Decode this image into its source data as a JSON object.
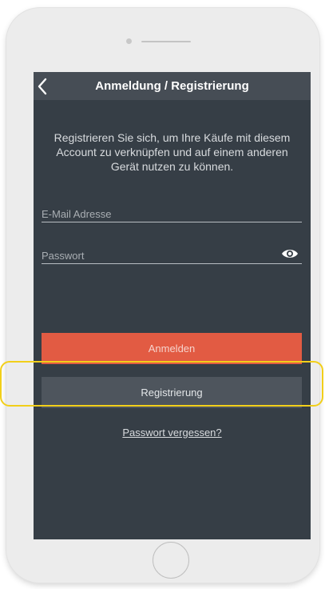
{
  "navbar": {
    "title": "Anmeldung / Registrierung",
    "back_icon": "chevron-left-icon"
  },
  "intro_text": "Registrieren Sie sich, um Ihre Käufe mit diesem Account zu verknüpfen und auf einem anderen Gerät nutzen zu können.",
  "form": {
    "email_placeholder": "E-Mail Adresse",
    "email_value": "",
    "password_placeholder": "Passwort",
    "password_value": "",
    "show_password_icon": "eye-icon"
  },
  "buttons": {
    "login_label": "Anmelden",
    "register_label": "Registrierung"
  },
  "forgot_password_link": "Passwort vergessen?",
  "colors": {
    "screen_background": "#363e46",
    "navbar_background": "#464d55",
    "login_button": "#e25b43",
    "register_button": "#4e555d",
    "highlight": "#f2cf1a"
  }
}
